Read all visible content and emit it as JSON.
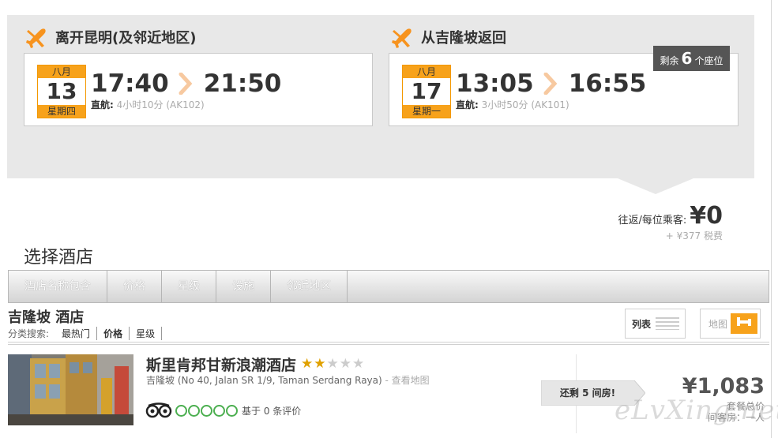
{
  "outbound": {
    "heading": "离开昆明(及邻近地区)",
    "month": "八月",
    "day": "13",
    "weekday": "星期四",
    "depart_time": "17:40",
    "arrive_time": "21:50",
    "direct_label": "直航:",
    "duration": "4小时10分 (AK102)"
  },
  "return": {
    "heading": "从吉隆坡返回",
    "month": "八月",
    "day": "17",
    "weekday": "星期一",
    "depart_time": "13:05",
    "arrive_time": "16:55",
    "direct_label": "直航:",
    "duration": "3小时50分 (AK101)",
    "seats_prefix": "剩余",
    "seats_count": "6",
    "seats_suffix": "个座位"
  },
  "price": {
    "label": "往返/每位乘客:",
    "value": "¥0",
    "tax": "+ ¥377 税费"
  },
  "hotel_section": {
    "title": "选择酒店",
    "filter_tabs": [
      "酒店名称包含",
      "价格",
      "星级",
      "设施",
      "邻近地区"
    ],
    "city_title": "吉隆坡 酒店",
    "sort_label": "分类搜索:",
    "sort_options": [
      "最热门",
      "价格",
      "星级"
    ],
    "active_sort": "价格",
    "view_list_label": "列表",
    "view_map_label": "地图"
  },
  "hotel": {
    "name": "斯里肯邦甘新浪潮酒店",
    "star_rating": 2,
    "star_max": 5,
    "address": "吉隆坡 (No 40, Jalan SR 1/9, Taman Serdang Raya)",
    "address_separator": " - ",
    "map_link": "查看地图",
    "review_text": "基于 0 条评价",
    "rooms_left": "还剩 5 间房!",
    "price": "¥1,083",
    "price_note_1": "套餐总价",
    "price_note_2": "间客房：一人"
  },
  "watermark": "eLvXing.net",
  "colors": {
    "accent_orange": "#f7a21b",
    "panel_gray": "#e8e8e8",
    "seats_badge": "#555555",
    "tripadvisor_green": "#4caf50"
  },
  "icons": {
    "plane": "plane-icon",
    "arrow": "chevron-right-icon",
    "list": "list-view-icon",
    "map": "map-pin-icon",
    "tripadvisor": "tripadvisor-owl-icon"
  }
}
